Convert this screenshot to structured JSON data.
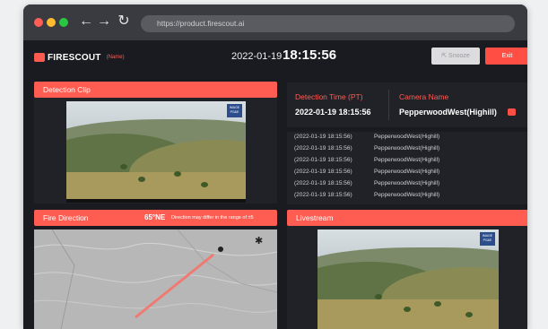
{
  "browser": {
    "url": "https://product.firescout.ai",
    "back_icon": "arrow-left",
    "forward_icon": "arrow-right",
    "reload_icon": "reload"
  },
  "header": {
    "logo_text": "FIRESCOUT",
    "logo_name": "(Name)",
    "date": "2022-01-19",
    "time": "18:15:56",
    "snooze_label": "Snooze",
    "exit_label": "Exit"
  },
  "detection_clip": {
    "title": "Detection Clip",
    "badge": "IMAGE PG&E"
  },
  "detection_info": {
    "time_label": "Detection Time (PT)",
    "time_value": "2022-01-19 18:15:56",
    "camera_label": "Camera Name",
    "camera_value": "PepperwoodWest(Highill)"
  },
  "log": [
    {
      "time": "(2022-01-19 18:15:56)",
      "camera": "PepperwoodWest(Highill)"
    },
    {
      "time": "(2022-01-19 18:15:56)",
      "camera": "PepperwoodWest(Highill)"
    },
    {
      "time": "(2022-01-19 18:15:56)",
      "camera": "PepperwoodWest(Highill)"
    },
    {
      "time": "(2022-01-19 18:15:56)",
      "camera": "PepperwoodWest(Highill)"
    },
    {
      "time": "(2022-01-19 18:15:56)",
      "camera": "PepperwoodWest(Highill)"
    },
    {
      "time": "(2022-01-19 18:15:56)",
      "camera": "PepperwoodWest(Highill)"
    }
  ],
  "fire_direction": {
    "title": "Fire Direction",
    "degrees": "65°NE",
    "note": "Direction may differ in the range of ±5"
  },
  "livestream": {
    "title": "Livestream",
    "badge": "IMAGE PG&E"
  },
  "colors": {
    "accent": "#ff5c52",
    "background": "#1a1b20",
    "panel": "#212228"
  }
}
